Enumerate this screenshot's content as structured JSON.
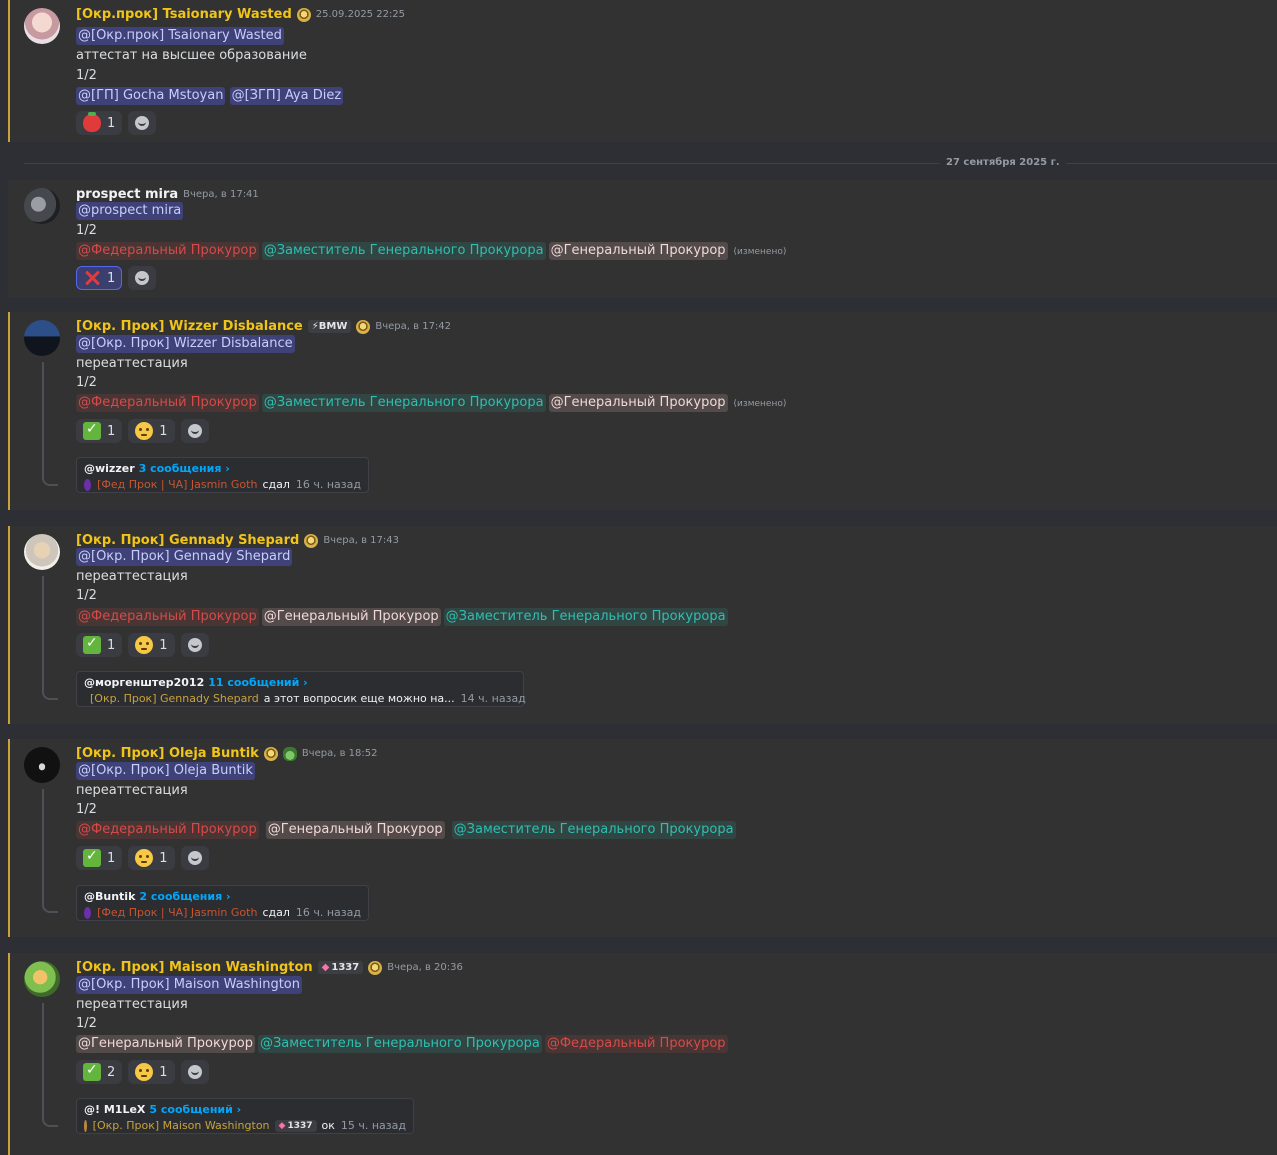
{
  "divider": "27 сентября 2025 г.",
  "messages": [
    {
      "author": "[Окр.прок] Tsaionary Wasted",
      "timestamp": "25.09.2025 22:25",
      "mention": "@[Окр.прок] Tsaionary Wasted",
      "line1": "аттестат на высшее образование",
      "line2": "1/2",
      "roles": [
        "@[ГП] Gocha Mstoyan",
        "@[ЗГП] Aya Diez"
      ],
      "reactions": [
        {
          "emoji": "strawberry",
          "count": "1"
        }
      ]
    },
    {
      "author": "prospect mira",
      "timestamp": "Вчера, в 17:41",
      "mention": "@prospect mira",
      "line2": "1/2",
      "roles": [
        "@Федеральный Прокурор",
        "@Заместитель Генерального Прокурора",
        "@Генеральный Прокурор"
      ],
      "edited": "(изменено)",
      "reactions": [
        {
          "emoji": "cross-mark",
          "count": "1"
        }
      ]
    },
    {
      "author": "[Окр. Прок] Wizzer Disbalance",
      "tag": "⚡BMW",
      "timestamp": "Вчера, в 17:42",
      "mention": "@[Окр. Прок] Wizzer Disbalance",
      "line1": "переаттестация",
      "line2": "1/2",
      "roles": [
        "@Федеральный Прокурор",
        "@Заместитель Генерального Прокурора",
        "@Генеральный Прокурор"
      ],
      "edited": "(изменено)",
      "reactions": [
        {
          "emoji": "check",
          "count": "1"
        },
        {
          "emoji": "thinking",
          "count": "1"
        }
      ],
      "thread": {
        "name": "@wizzer",
        "count": "3 сообщения ›",
        "author": "[Фед Прок | ЧА] Jasmin Goth",
        "text": "сдал",
        "time": "16 ч. назад"
      }
    },
    {
      "author": "[Окр. Прок] Gennady Shepard",
      "timestamp": "Вчера, в 17:43",
      "mention": "@[Окр. Прок] Gennady Shepard",
      "line1": "переаттестация",
      "line2": "1/2",
      "roles": [
        "@Федеральный Прокурор",
        "@Генеральный Прокурор",
        "@Заместитель Генерального Прокурора"
      ],
      "reactions": [
        {
          "emoji": "check",
          "count": "1"
        },
        {
          "emoji": "thinking",
          "count": "1"
        }
      ],
      "thread": {
        "name": "@моргенштер2012",
        "count": "11 сообщений ›",
        "author": "[Окр. Прок] Gennady Shepard",
        "text": "а этот вопросик еще можно на...",
        "time": "14 ч. назад"
      }
    },
    {
      "author": "[Окр. Прок] Oleja Buntik",
      "timestamp": "Вчера, в 18:52",
      "mention": "@[Окр. Прок] Oleja Buntik",
      "line1": "переаттестация",
      "line2": "1/2",
      "roles": [
        "@Федеральный Прокурор",
        "@Генеральный Прокурор",
        "@Заместитель Генерального Прокурора"
      ],
      "reactions": [
        {
          "emoji": "check",
          "count": "1"
        },
        {
          "emoji": "thinking",
          "count": "1"
        }
      ],
      "thread": {
        "name": "@Buntik",
        "count": "2 сообщения ›",
        "author": "[Фед Прок | ЧА] Jasmin Goth",
        "text": "сдал",
        "time": "16 ч. назад"
      }
    },
    {
      "author": "[Окр. Прок] Maison Washington",
      "tag": "1337",
      "timestamp": "Вчера, в 20:36",
      "mention": "@[Окр. Прок] Maison Washington",
      "line1": "переаттестация",
      "line2": "1/2",
      "roles": [
        "@Генеральный Прокурор",
        "@Заместитель Генерального Прокурора",
        "@Федеральный Прокурор"
      ],
      "reactions": [
        {
          "emoji": "check",
          "count": "2"
        },
        {
          "emoji": "thinking",
          "count": "1"
        }
      ],
      "thread": {
        "name": "@! M1LeX",
        "count": "5 сообщений ›",
        "author": "[Окр. Прок] Maison Washington",
        "tag": "1337",
        "text": "ок",
        "time": "15 ч. назад"
      }
    }
  ]
}
